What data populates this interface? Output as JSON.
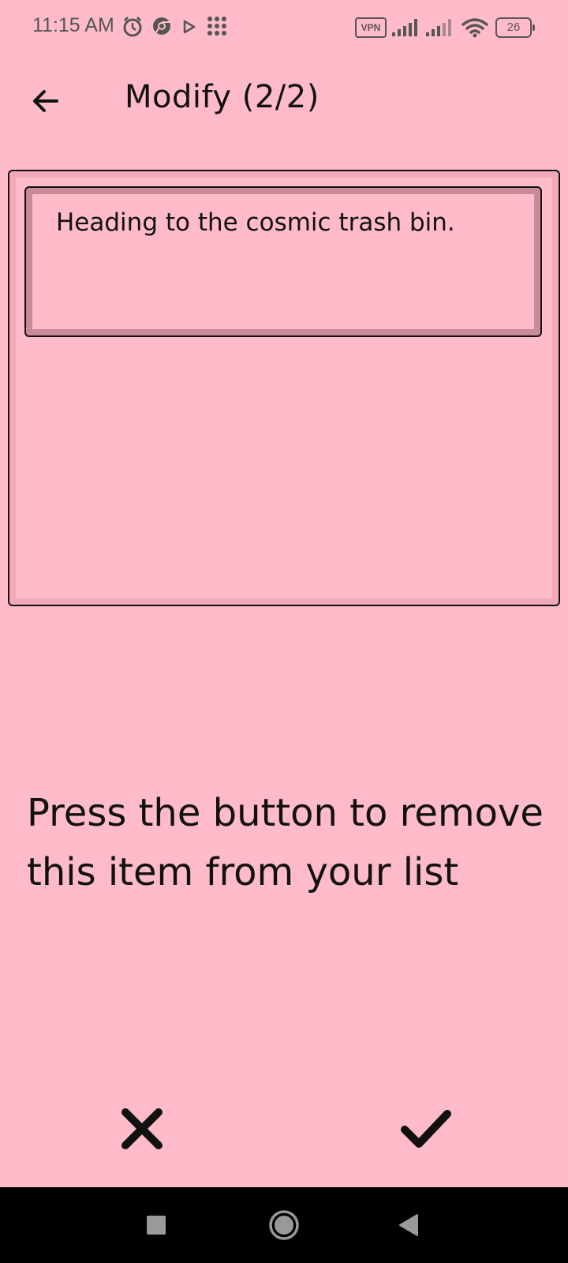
{
  "status_bar": {
    "time": "11:15 AM",
    "vpn": "VPN",
    "battery": "26",
    "icons": [
      "alarm-icon",
      "chrome-icon",
      "play-icon",
      "apps-grid-icon",
      "signal-icon",
      "signal-icon",
      "wifi-icon",
      "battery-icon"
    ]
  },
  "header": {
    "title": "Modify (2/2)",
    "back_icon": "arrow-left-icon"
  },
  "note": {
    "text": "Heading to the cosmic trash bin."
  },
  "message": {
    "text": "Press the button to remove this item from your list"
  },
  "actions": {
    "cancel_icon": "close-icon",
    "confirm_icon": "check-icon"
  },
  "nav": {
    "icons": [
      "recents-square-icon",
      "home-circle-icon",
      "back-triangle-icon"
    ]
  },
  "colors": {
    "background": "#ffbbca",
    "card_border": "#111111",
    "card_bevel": "#f2a9b8",
    "field_bevel": "#c98a98",
    "nav_bar": "#000000"
  }
}
